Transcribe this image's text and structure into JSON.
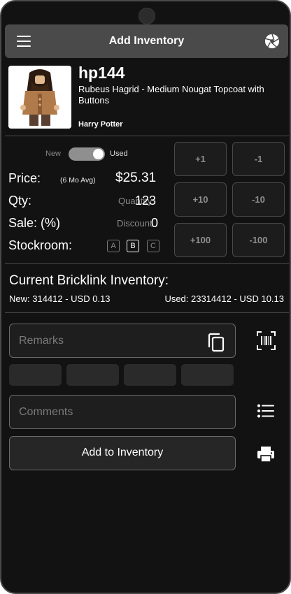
{
  "appbar": {
    "title": "Add Inventory"
  },
  "item": {
    "id": "hp144",
    "name": "Rubeus Hagrid - Medium Nougat Topcoat with Buttons",
    "theme": "Harry Potter"
  },
  "condition": {
    "new_label": "New",
    "used_label": "Used",
    "selected": "Used"
  },
  "price": {
    "label": "Price:",
    "note": "(6 Mo Avg)",
    "value": "$25.31"
  },
  "qty": {
    "label": "Qty:",
    "hint": "Quantity",
    "value": "123"
  },
  "sale": {
    "label": "Sale: (%)",
    "hint": "Discount",
    "value": "0"
  },
  "stockroom": {
    "label": "Stockroom:",
    "options": [
      "A",
      "B",
      "C"
    ],
    "selected": "B"
  },
  "steppers": {
    "plus1": "+1",
    "minus1": "-1",
    "plus10": "+10",
    "minus10": "-10",
    "plus100": "+100",
    "minus100": "-100"
  },
  "inventory": {
    "title": "Current Bricklink Inventory:",
    "new_text": "New: 314412 - USD 0.13",
    "used_text": "Used: 23314412 - USD 10.13"
  },
  "remarks": {
    "placeholder": "Remarks"
  },
  "comments": {
    "placeholder": "Comments"
  },
  "actions": {
    "add_label": "Add to Inventory"
  },
  "colors": {
    "background": "#121212",
    "appbar": "#4a4a4a",
    "border": "#6a6a6a"
  }
}
